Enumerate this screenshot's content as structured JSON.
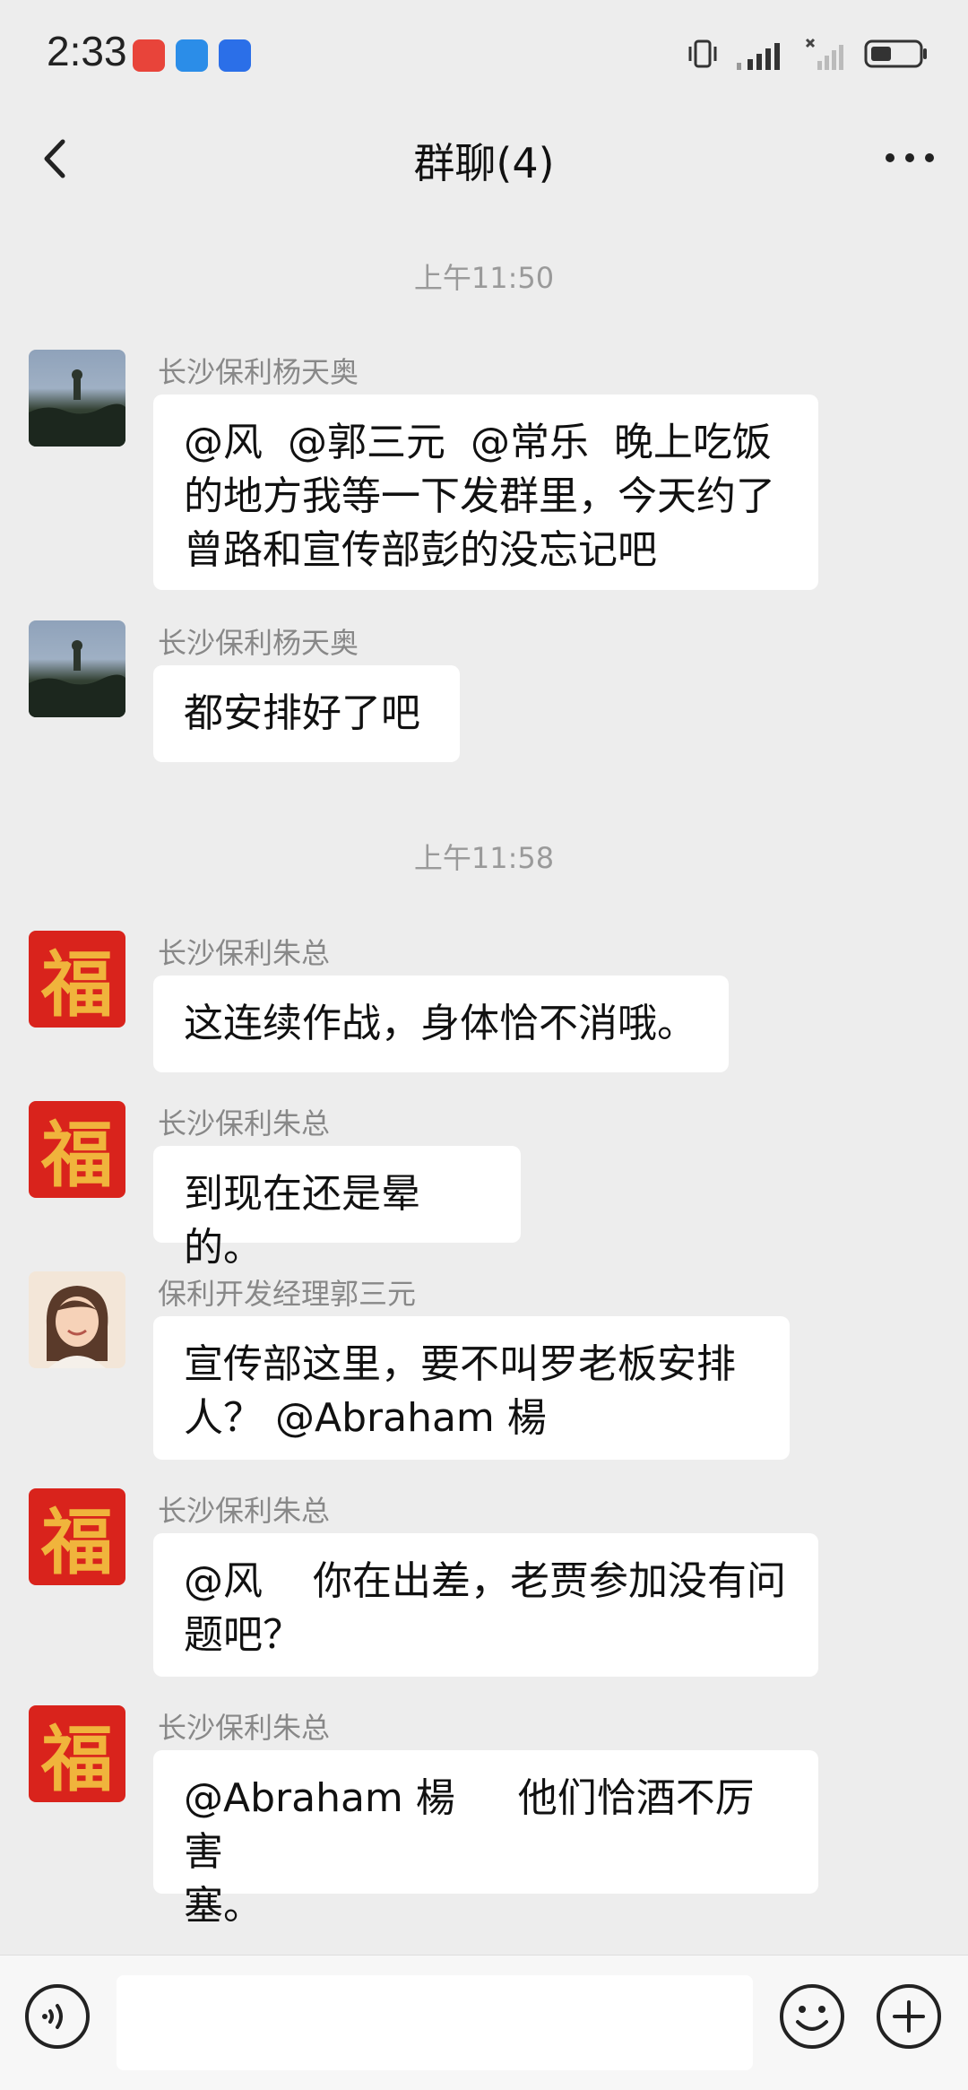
{
  "status_bar": {
    "time": "2:33",
    "app_icons": [
      {
        "name": "huawei-app-icon",
        "color": "#e8443a"
      },
      {
        "name": "assistant-app-icon",
        "color": "#2b8de8"
      },
      {
        "name": "voice-app-icon",
        "color": "#2b6fe8"
      }
    ]
  },
  "header": {
    "title": "群聊(4)"
  },
  "timestamps": [
    "上午11:50",
    "上午11:58"
  ],
  "messages": [
    {
      "sender": "长沙保利杨天奥",
      "avatar": "landscape-photo-avatar",
      "text": "@风  @郭三元  @常乐  晚上吃饭\n的地方我等一下发群里，今天约了\n曾路和宣传部彭的没忘记吧"
    },
    {
      "sender": "长沙保利杨天奥",
      "avatar": "landscape-photo-avatar",
      "text": "都安排好了吧"
    },
    {
      "sender": "长沙保利朱总",
      "avatar": "fu-character-avatar",
      "text": "这连续作战，身体恰不消哦。"
    },
    {
      "sender": "长沙保利朱总",
      "avatar": "fu-character-avatar",
      "text": "到现在还是晕的。"
    },
    {
      "sender": "保利开发经理郭三元",
      "avatar": "woman-portrait-avatar",
      "text": "宣传部这里，要不叫罗老板安排\n人？ @Abraham 楊"
    },
    {
      "sender": "长沙保利朱总",
      "avatar": "fu-character-avatar",
      "text": "@风    你在出差，老贾参加没有问\n题吧？"
    },
    {
      "sender": "长沙保利朱总",
      "avatar": "fu-character-avatar",
      "text": "@Abraham 楊     他们恰酒不厉害\n塞。"
    }
  ],
  "avatar_glyph": "福",
  "colors": {
    "background": "#ededed",
    "bubble": "#ffffff",
    "fu_red": "#d9231c",
    "fu_gold": "#f0b43c"
  }
}
